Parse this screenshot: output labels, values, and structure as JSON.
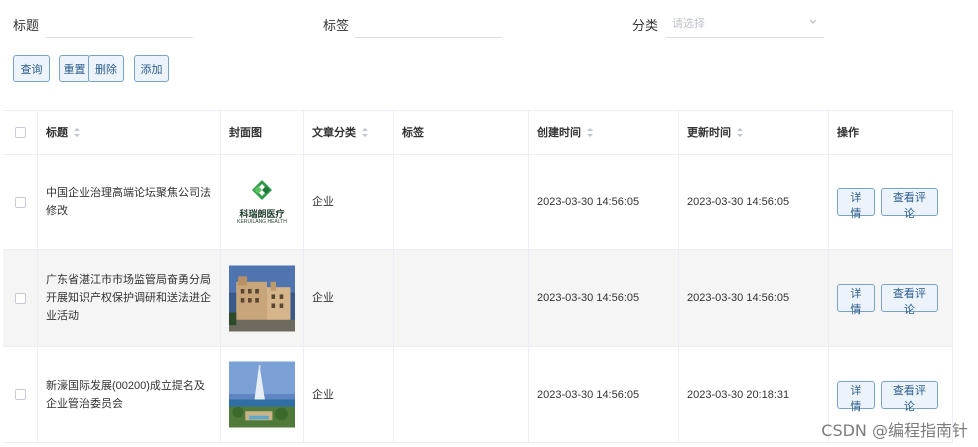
{
  "search": {
    "title_label": "标题",
    "title_value": "",
    "tag_label": "标签",
    "tag_value": "",
    "category_label": "分类",
    "category_placeholder": "请选择"
  },
  "toolbar": {
    "query": "查询",
    "reset": "重置",
    "delete": "删除",
    "add": "添加"
  },
  "table": {
    "headers": {
      "title": "标题",
      "cover": "封面图",
      "category": "文章分类",
      "tags": "标签",
      "created": "创建时间",
      "updated": "更新时间",
      "actions": "操作"
    },
    "rows": [
      {
        "title": "中国企业治理高端论坛聚焦公司法修改",
        "cover": "logo",
        "cover_text": "科瑞朗医疗",
        "cover_subtext": "KERUILANG HEALTH",
        "category": "企业",
        "tags": "",
        "created": "2023-03-30 14:56:05",
        "updated": "2023-03-30 14:56:05"
      },
      {
        "title": "广东省湛江市市场监管局奋勇分局开展知识产权保护调研和送法进企业活动",
        "cover": "building",
        "category": "企业",
        "tags": "",
        "created": "2023-03-30 14:56:05",
        "updated": "2023-03-30 14:56:05"
      },
      {
        "title": "新濠国际发展(00200)成立提名及企业管治委员会",
        "cover": "resort",
        "category": "企业",
        "tags": "",
        "created": "2023-03-30 14:56:05",
        "updated": "2023-03-30 20:18:31"
      }
    ],
    "detail_label": "详情",
    "comments_label": "查看评论"
  },
  "watermark": "CSDN @编程指南针"
}
